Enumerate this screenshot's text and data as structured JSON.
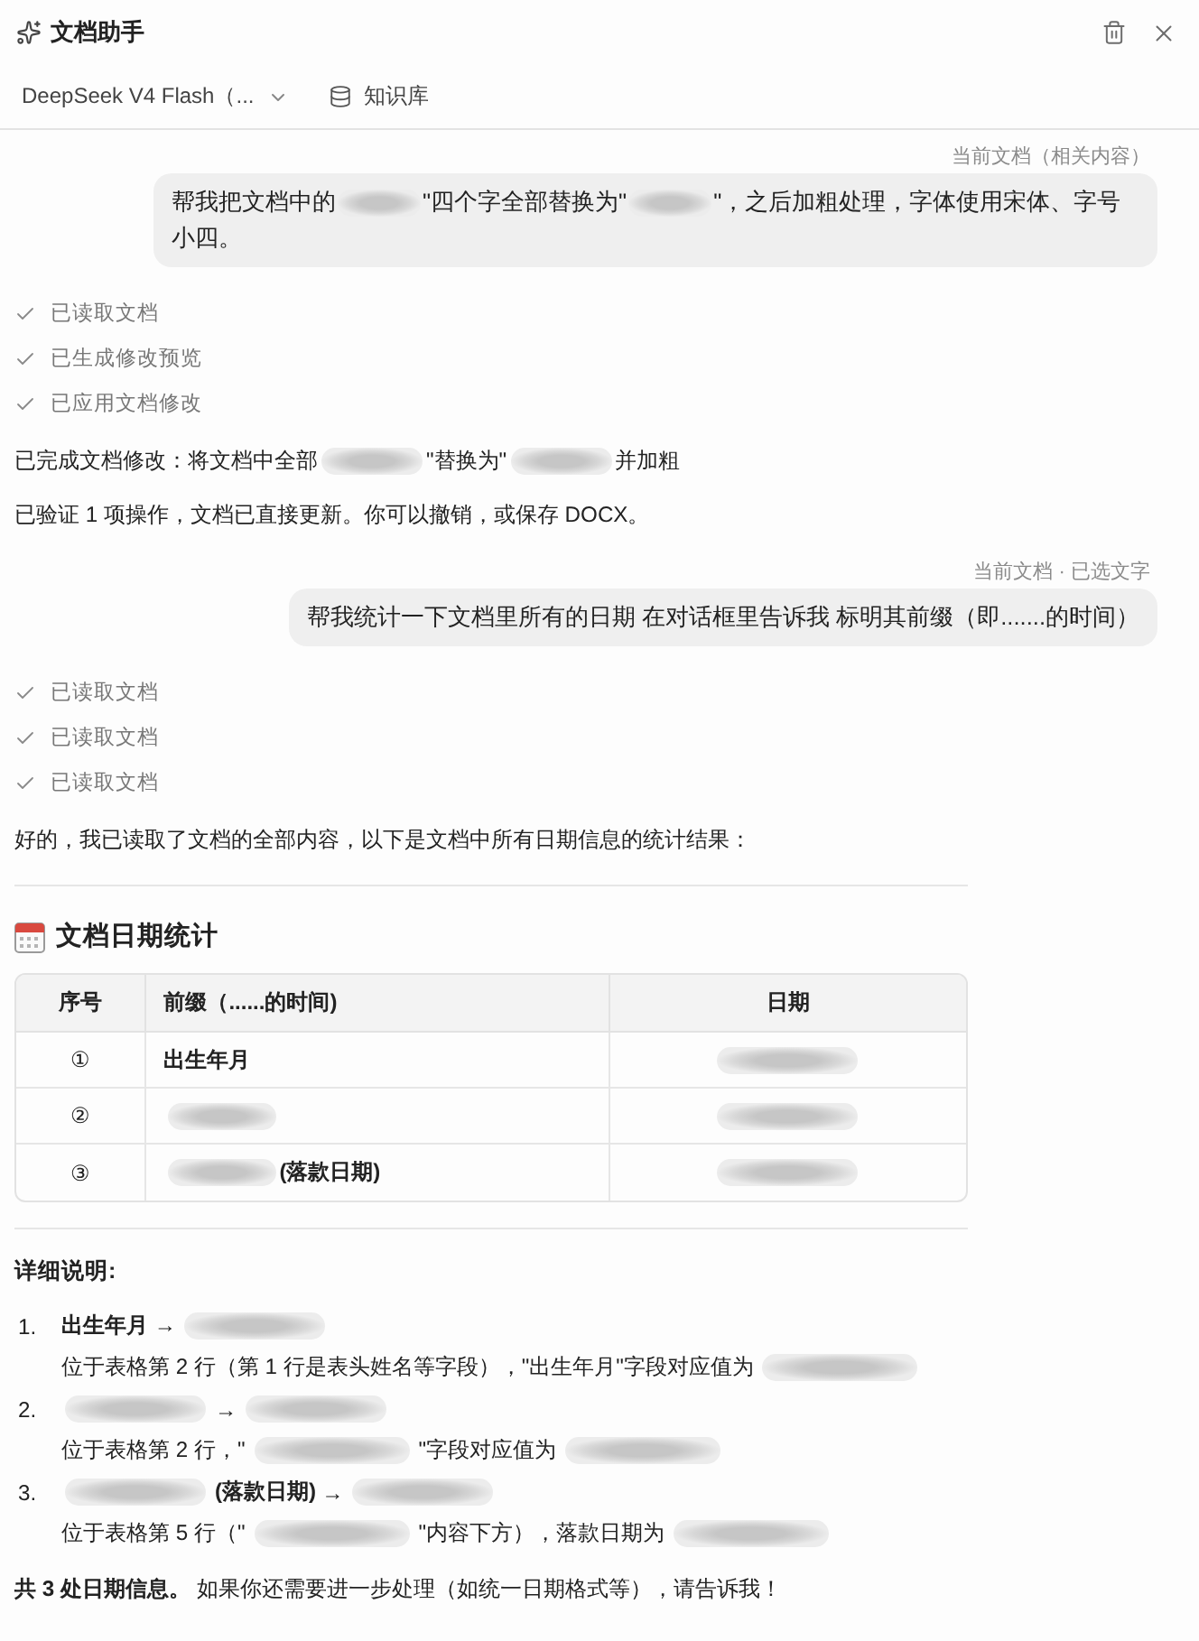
{
  "header": {
    "title": "文档助手"
  },
  "toolbar": {
    "model": "DeepSeek V4 Flash（...",
    "knowledge_base": "知识库"
  },
  "conversation": [
    {
      "kind": "user",
      "context": "当前文档（相关内容）",
      "segments": [
        {
          "kind": "text",
          "text": "帮我把文档中的"
        },
        {
          "kind": "redacted"
        },
        {
          "kind": "text",
          "text": "\"四个字全部替换为\""
        },
        {
          "kind": "redacted"
        },
        {
          "kind": "text",
          "text": "\"，之后加粗处理，字体使用宋体、字号小四。"
        }
      ]
    },
    {
      "kind": "assistant",
      "steps": [
        {
          "label": "已读取文档",
          "done": true
        },
        {
          "label": "已生成修改预览",
          "done": true
        },
        {
          "label": "已应用文档修改",
          "done": true
        }
      ],
      "blocks": [
        {
          "kind": "paragraph",
          "segments": [
            {
              "kind": "text",
              "text": "已完成文档修改：将文档中全部"
            },
            {
              "kind": "redacted"
            },
            {
              "kind": "text",
              "text": "\"替换为\""
            },
            {
              "kind": "redacted"
            },
            {
              "kind": "text",
              "text": "并加粗"
            }
          ]
        },
        {
          "kind": "paragraph",
          "segments": [
            {
              "kind": "text",
              "text": "已验证 1 项操作，文档已直接更新。你可以撤销，或保存 DOCX。"
            }
          ]
        }
      ]
    },
    {
      "kind": "user",
      "context": "当前文档 · 已选文字",
      "segments": [
        {
          "kind": "text",
          "text": "帮我统计一下文档里所有的日期 在对话框里告诉我 标明其前缀（即.......的时间）"
        }
      ]
    },
    {
      "kind": "assistant",
      "steps": [
        {
          "label": "已读取文档",
          "done": true
        },
        {
          "label": "已读取文档",
          "done": true
        },
        {
          "label": "已读取文档",
          "done": true
        }
      ],
      "blocks": [
        {
          "kind": "paragraph",
          "segments": [
            {
              "kind": "text",
              "text": "好的，我已读取了文档的全部内容，以下是文档中所有日期信息的统计结果："
            }
          ]
        },
        {
          "kind": "divider"
        },
        {
          "kind": "table_title",
          "text": "文档日期统计"
        },
        {
          "kind": "table",
          "columns": [
            "序号",
            "前缀（......的时间)",
            "日期"
          ],
          "rows": [
            [
              [
                {
                  "kind": "text",
                  "text": "①"
                }
              ],
              [
                {
                  "kind": "strong",
                  "text": "出生年月"
                }
              ],
              [
                {
                  "kind": "redacted"
                }
              ]
            ],
            [
              [
                {
                  "kind": "text",
                  "text": "②"
                }
              ],
              [
                {
                  "kind": "redacted"
                }
              ],
              [
                {
                  "kind": "redacted"
                }
              ]
            ],
            [
              [
                {
                  "kind": "text",
                  "text": "③"
                }
              ],
              [
                {
                  "kind": "redacted"
                },
                {
                  "kind": "strong",
                  "text": "(落款日期)"
                }
              ],
              [
                {
                  "kind": "redacted"
                }
              ]
            ]
          ]
        },
        {
          "kind": "divider"
        },
        {
          "kind": "subheading",
          "text": "详细说明:"
        },
        {
          "kind": "list",
          "items": [
            {
              "marker": "1.",
              "title": [
                {
                  "kind": "strong",
                  "text": "出生年月 →"
                },
                {
                  "kind": "redacted"
                }
              ],
              "detail": [
                {
                  "kind": "text",
                  "text": "位于表格第 2 行（第 1 行是表头姓名等字段），\"出生年月\"字段对应值为"
                },
                {
                  "kind": "redacted"
                }
              ]
            },
            {
              "marker": "2.",
              "title": [
                {
                  "kind": "redacted"
                },
                {
                  "kind": "text",
                  "text": "→"
                },
                {
                  "kind": "redacted"
                }
              ],
              "detail": [
                {
                  "kind": "text",
                  "text": "位于表格第 2 行，\""
                },
                {
                  "kind": "redacted"
                },
                {
                  "kind": "text",
                  "text": "\"字段对应值为"
                },
                {
                  "kind": "redacted"
                }
              ]
            },
            {
              "marker": "3.",
              "title": [
                {
                  "kind": "redacted"
                },
                {
                  "kind": "strong",
                  "text": "(落款日期)"
                },
                {
                  "kind": "text",
                  "text": "→"
                },
                {
                  "kind": "redacted"
                }
              ],
              "detail": [
                {
                  "kind": "text",
                  "text": "位于表格第 5 行（\""
                },
                {
                  "kind": "redacted"
                },
                {
                  "kind": "text",
                  "text": "\"内容下方），落款日期为"
                },
                {
                  "kind": "redacted"
                }
              ]
            }
          ]
        },
        {
          "kind": "note",
          "text": "**共 3 处日期信息。** 如果你还需要进一步处理（如统一日期格式等），请告诉我！"
        }
      ]
    }
  ]
}
